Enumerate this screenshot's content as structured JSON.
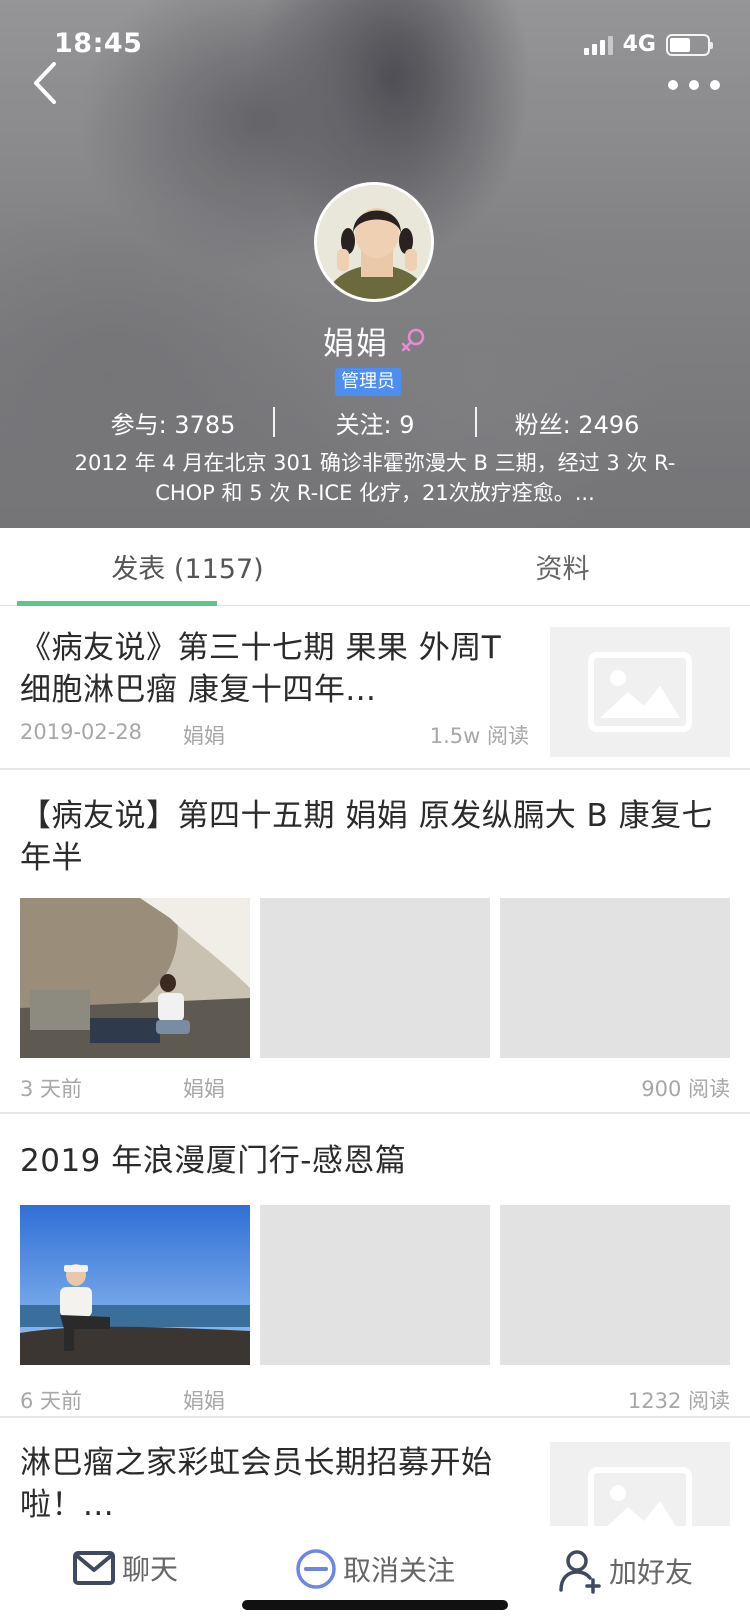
{
  "status_bar": {
    "time": "18:45",
    "network": "4G",
    "battery_level": 0.55
  },
  "profile": {
    "name": "娟娟",
    "gender_icon": "female-icon",
    "badge": "管理员",
    "stats": [
      {
        "label": "参与: 3785"
      },
      {
        "label": "关注: 9"
      },
      {
        "label": "粉丝: 2496"
      }
    ],
    "bio": "2012 年 4 月在北京 301 确诊非霍弥漫大 B 三期，经过 3 次 R-CHOP 和 5 次 R-ICE 化疗，21次放疗痊愈。..."
  },
  "tabs": [
    {
      "label": "发表 (1157)",
      "active": true
    },
    {
      "label": "资料",
      "active": false
    }
  ],
  "posts": [
    {
      "title": "《病友说》第三十七期 果果 外周T细胞淋巴瘤 康复十四年...",
      "date": "2019-02-28",
      "author": "娟娟",
      "reads": "1.5w 阅读"
    },
    {
      "title": "【病友说】第四十五期 娟娟 原发纵膈大 B 康复七年半",
      "date": "3 天前",
      "author": "娟娟",
      "reads": "900 阅读"
    },
    {
      "title": "2019 年浪漫厦门行-感恩篇",
      "date": "6 天前",
      "author": "娟娟",
      "reads": "1232 阅读"
    },
    {
      "title": "淋巴瘤之家彩虹会员长期招募开始啦！..."
    }
  ],
  "bottom_bar": {
    "chat": "聊天",
    "unfollow": "取消关注",
    "add_friend": "加好友"
  },
  "colors": {
    "accent_green": "#5ec487",
    "badge_blue": "#4c8ff0",
    "female_pink": "#e88bd6",
    "icon_blue": "#6c86e8"
  }
}
